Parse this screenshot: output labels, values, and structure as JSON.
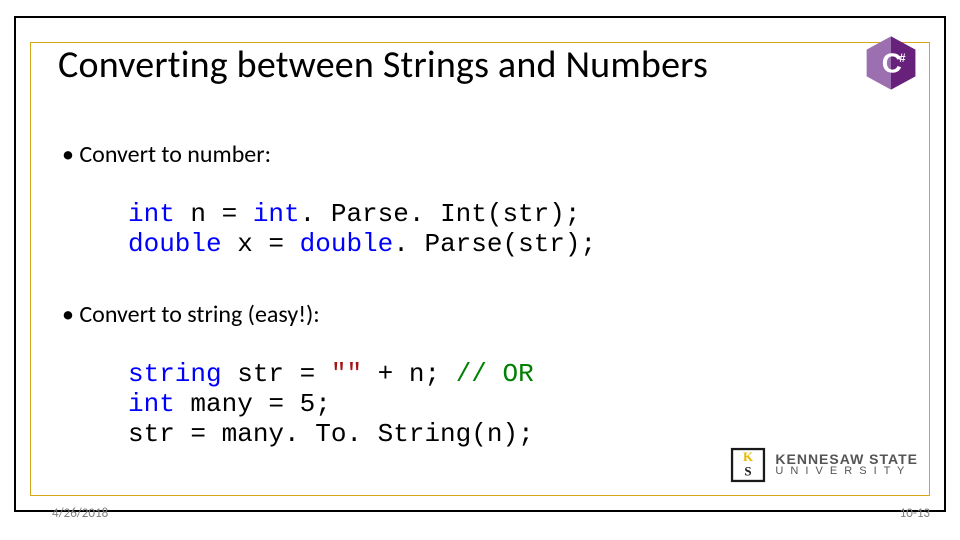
{
  "title": "Converting between Strings and Numbers",
  "bullets": {
    "b1": "• Convert to number:",
    "b2": "• Convert to string (easy!):"
  },
  "code1": {
    "kw1": "int",
    "p1": " n = ",
    "kw2": "int",
    "p2": ". Parse. Int(str);",
    "kw3": "double",
    "p3": " x = ",
    "kw4": "double",
    "p4": ". Parse(str);"
  },
  "code2": {
    "kw1": "string",
    "p1": " str = ",
    "str1": "\"\"",
    "p2": " + n; ",
    "cmt": "// OR",
    "kw2": "int",
    "p3": " many = 5;",
    "p4": "str = many. To. String(n);"
  },
  "footer": {
    "date": "4/26/2018",
    "page": "10-13"
  },
  "logos": {
    "csharp": "C#",
    "ksu_line1": "KENNESAW STATE",
    "ksu_line2": "U N I V E R S I T Y"
  },
  "colors": {
    "accent_gold": "#D4A61A",
    "keyword": "#0000FF",
    "comment": "#008000",
    "string": "#A31515",
    "csharp_purple": "#68217A"
  }
}
